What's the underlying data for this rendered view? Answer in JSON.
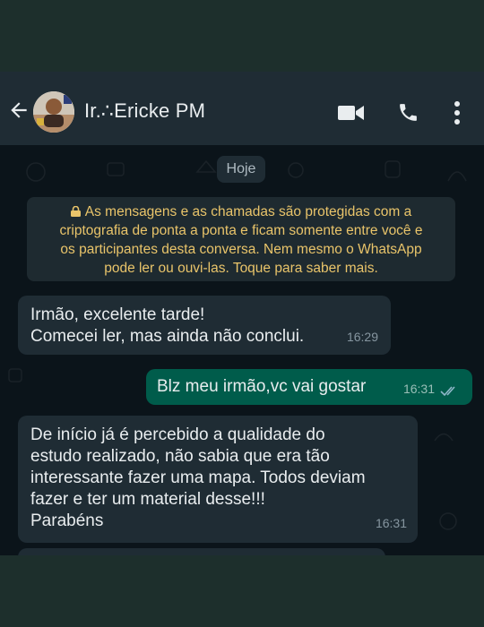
{
  "header": {
    "contact_name": "Ir.∴Ericke PM"
  },
  "chat": {
    "date_chip": "Hoje",
    "encryption_notice": [
      "As mensagens e as chamadas são protegidas com a",
      "criptografia de ponta a ponta e ficam somente entre você e",
      "os participantes desta conversa. Nem mesmo o WhatsApp",
      "pode ler ou ouvi-las. Toque para saber mais."
    ],
    "messages": [
      {
        "direction": "incoming",
        "lines": [
          "Irmão, excelente tarde!",
          "Comecei ler, mas ainda não conclui."
        ],
        "time": "16:29"
      },
      {
        "direction": "outgoing",
        "lines": [
          "Blz meu irmão,vc vai gostar"
        ],
        "time": "16:31",
        "status": "read"
      },
      {
        "direction": "incoming",
        "lines": [
          "De início já é percebido a qualidade do",
          "estudo realizado, não sabia que era tão",
          "interessante fazer uma mapa. Todos deviam",
          "fazer e ter um material desse!!!",
          "Parabéns"
        ],
        "time": "16:31"
      }
    ]
  },
  "colors": {
    "header_bg": "#1f2c34",
    "chat_bg": "#0b141a",
    "incoming_bubble": "#1f2c34",
    "outgoing_bubble": "#005c4b",
    "notice_text": "#e9c46a",
    "read_ticks": "#53bdeb"
  },
  "icons": [
    "back-arrow-icon",
    "video-call-icon",
    "phone-icon",
    "more-options-icon",
    "lock-icon",
    "double-check-icon"
  ]
}
